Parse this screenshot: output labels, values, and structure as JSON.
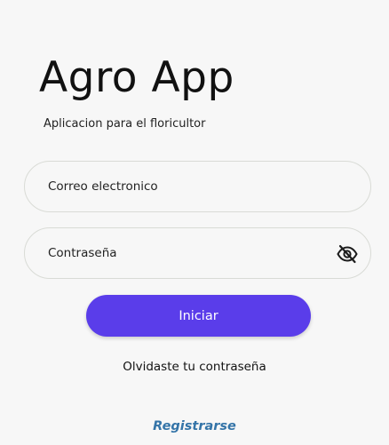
{
  "app": {
    "title": "Agro App",
    "subtitle": "Aplicacion para el floricultor"
  },
  "form": {
    "email_placeholder": "Correo electronico",
    "email_value": "",
    "password_placeholder": "Contraseña",
    "password_value": "",
    "password_toggle_icon": "eye-off-icon",
    "login_label": "Iniciar",
    "forgot_label": "Olvidaste tu contraseña",
    "register_label": "Registrarse"
  },
  "colors": {
    "primary_button": "#5a3dea",
    "register_link": "#3474a8",
    "background": "#f7f7f7",
    "field_border": "#d9dbd6"
  }
}
